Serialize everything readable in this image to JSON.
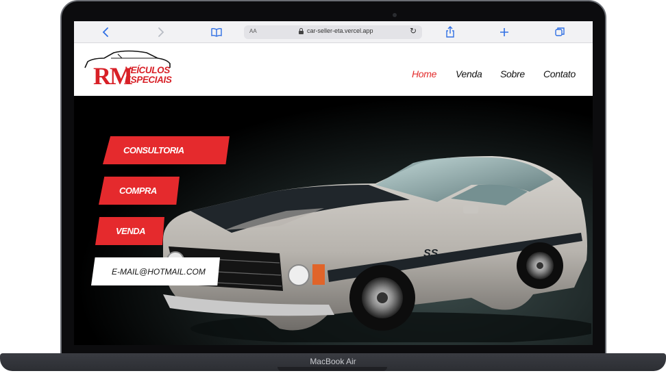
{
  "device": {
    "label": "MacBook Air"
  },
  "browser": {
    "text_size_label": "AA",
    "url": "car-seller-eta.vercel.app",
    "icons": [
      "back-icon",
      "forward-icon",
      "bookmarks-icon",
      "reload-icon",
      "share-icon",
      "new-tab-icon",
      "tabs-icon"
    ]
  },
  "site": {
    "logo": {
      "initials": "RM",
      "line1": "VEÍCULOS",
      "line2": "ESPECIAIS"
    },
    "nav": {
      "home": "Home",
      "venda": "Venda",
      "sobre": "Sobre",
      "contato": "Contato"
    },
    "hero": {
      "consultoria": "CONSULTORIA",
      "compra": "COMPRA",
      "venda": "VENDA",
      "email": "E-MAIL@HOTMAIL.COM"
    },
    "colors": {
      "brand_red": "#e52a2d",
      "nav_active": "#e32b2b"
    }
  }
}
